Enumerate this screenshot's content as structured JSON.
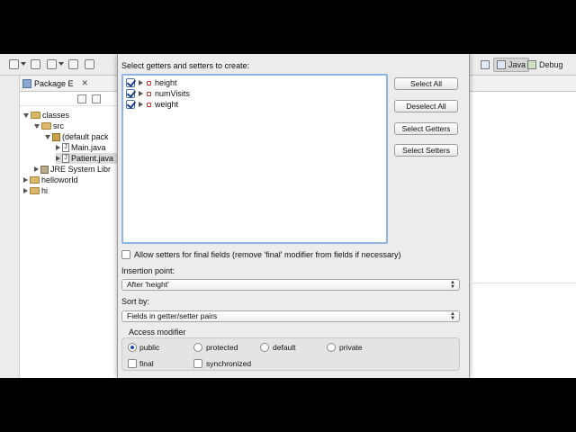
{
  "toolbar": {
    "icons": [
      "new-icon",
      "open-icon",
      "new-class-icon",
      "refresh-icon"
    ],
    "perspectives": [
      {
        "name": "table-icon",
        "label": ""
      },
      {
        "name": "java-perspective",
        "label": "Java"
      },
      {
        "name": "debug-perspective",
        "label": "Debug"
      }
    ]
  },
  "package_explorer": {
    "tab_label": "Package E",
    "close_glyph": "✕",
    "tree": [
      {
        "label": "classes",
        "icon": "project-icon",
        "level": 0,
        "expanded": true
      },
      {
        "label": "src",
        "icon": "folder-icon",
        "level": 1,
        "expanded": true
      },
      {
        "label": "(default pack",
        "icon": "package-icon",
        "level": 2,
        "expanded": true
      },
      {
        "label": "Main.java",
        "icon": "java-file-icon",
        "level": 3,
        "expanded": false
      },
      {
        "label": "Patient.java",
        "icon": "java-file-icon",
        "level": 3,
        "expanded": false,
        "selected": true
      },
      {
        "label": "JRE System Libr",
        "icon": "library-icon",
        "level": 1,
        "expanded": false
      },
      {
        "label": "helloworld",
        "icon": "project-icon",
        "level": 0,
        "expanded": false
      },
      {
        "label": "hi",
        "icon": "project-icon",
        "level": 0,
        "expanded": false
      }
    ]
  },
  "dialog": {
    "header": "Select getters and setters to create:",
    "fields": [
      {
        "label": "height",
        "checked": true
      },
      {
        "label": "numVisits",
        "checked": true
      },
      {
        "label": "weight",
        "checked": true
      }
    ],
    "buttons": {
      "select_all": "Select All",
      "deselect_all": "Deselect All",
      "select_getters": "Select Getters",
      "select_setters": "Select Setters"
    },
    "allow_final": {
      "label": "Allow setters for final fields (remove 'final' modifier from fields if necessary)",
      "checked": false
    },
    "insertion_point": {
      "label": "Insertion point:",
      "value": "After 'height'"
    },
    "sort_by": {
      "label": "Sort by:",
      "value": "Fields in getter/setter pairs"
    },
    "access_modifier": {
      "label": "Access modifier",
      "options": [
        {
          "label": "public",
          "selected": true
        },
        {
          "label": "protected",
          "selected": false
        },
        {
          "label": "default",
          "selected": false
        },
        {
          "label": "private",
          "selected": false
        }
      ],
      "final_label": "final",
      "final_checked": false,
      "synchronized_label": "synchronized",
      "synchronized_checked": false
    }
  },
  "colors": {
    "list_focus_border": "#8fb4e6",
    "radio_dot": "#1a4fa8",
    "field_icon": "#c0392b"
  }
}
